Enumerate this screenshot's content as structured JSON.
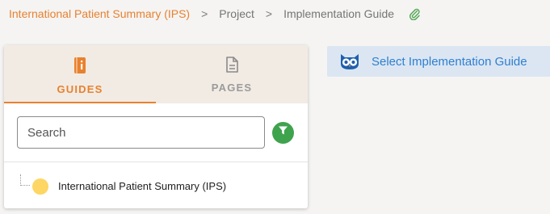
{
  "breadcrumb": {
    "items": [
      {
        "label": "International Patient Summary (IPS)"
      },
      {
        "label": "Project"
      },
      {
        "label": "Implementation Guide"
      }
    ],
    "separator": ">",
    "attach_icon": "paperclip-icon"
  },
  "panel": {
    "tabs": [
      {
        "label": "GUIDES",
        "icon": "guide-book-icon",
        "active": true
      },
      {
        "label": "PAGES",
        "icon": "document-icon",
        "active": false
      }
    ],
    "search": {
      "placeholder": "Search",
      "value": ""
    },
    "filter_icon": "filter-icon",
    "tree": [
      {
        "label": "International Patient Summary (IPS)",
        "status_color": "#fdd663"
      }
    ]
  },
  "banner": {
    "icon": "owl-icon",
    "text": "Select Implementation Guide"
  },
  "colors": {
    "accent": "#e8812f",
    "link_blue": "#2f7fd0",
    "filter_green": "#3fa34d",
    "tab_bg": "#f2ebe4",
    "banner_bg": "#dbe6f2"
  }
}
